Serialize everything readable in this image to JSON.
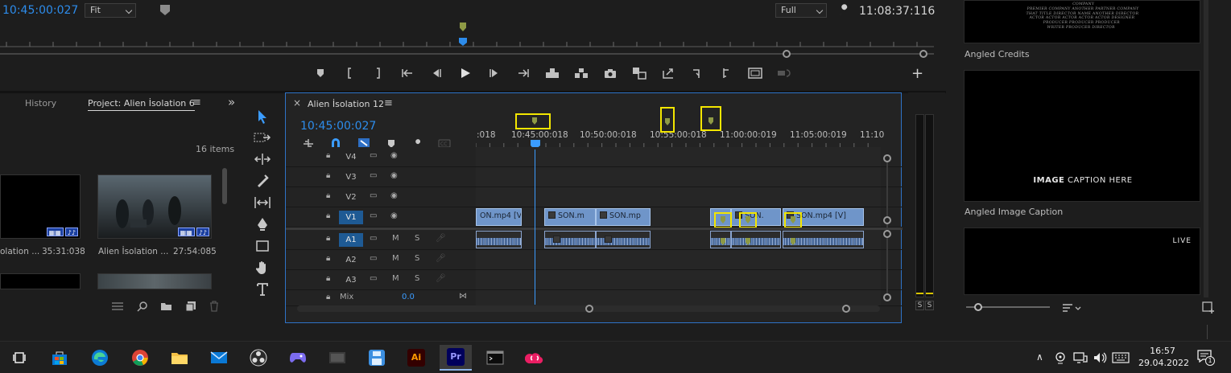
{
  "monitor": {
    "timecode_left": "10:45:00:027",
    "zoom_select": "Fit",
    "quality_select": "Full",
    "timecode_right": "11:08:37:116",
    "transport_icons": [
      "marker-icon",
      "mark-in-icon",
      "mark-out-icon",
      "go-to-in-icon",
      "step-back-icon",
      "play-icon",
      "step-forward-icon",
      "go-to-out-icon",
      "lift-icon",
      "extract-icon",
      "export-frame-icon",
      "compare-icon",
      "insert-icon",
      "trim-icon",
      "trim-end-icon",
      "safe-margins-icon",
      "vr-icon"
    ],
    "add_button": "+"
  },
  "project": {
    "tab_history": "History",
    "tab_project": "Project: Alien İsolation 6",
    "tab_menu": "≡",
    "overflow": "»",
    "item_count": "16 items",
    "items": [
      {
        "name": "olation ...",
        "duration": "35:31:038"
      },
      {
        "name": "Alien İsolation ...",
        "duration": "27:54:085"
      }
    ]
  },
  "timeline": {
    "close": "×",
    "sequence_name": "Alien İsolation 12",
    "menu": "≡",
    "timecode": "10:45:00:027",
    "ruler_ticks": [
      ":018",
      "10:45:00:018",
      "10:50:00:018",
      "10:55:00:018",
      "11:00:00:019",
      "11:05:00:019",
      "11:10"
    ],
    "tracks": [
      {
        "name": "V4",
        "type": "video"
      },
      {
        "name": "V3",
        "type": "video"
      },
      {
        "name": "V2",
        "type": "video"
      },
      {
        "name": "V1",
        "type": "video",
        "selected": true
      },
      {
        "name": "A1",
        "type": "audio",
        "selected": true
      },
      {
        "name": "A2",
        "type": "audio"
      },
      {
        "name": "A3",
        "type": "audio"
      }
    ],
    "mute_label": "M",
    "solo_label": "S",
    "mix_label": "Mix",
    "mix_value": "0.0",
    "video_clips": [
      "ON.mp4 [V]",
      "SON.m",
      "SON.mp",
      "",
      "SON.",
      "SON.mp4 [V]"
    ]
  },
  "meter": {
    "solo_left": "S",
    "solo_right": "S"
  },
  "essential": {
    "credits_lines": [
      "COMPANY",
      "PREMIER COMPANY ANOTHER PARTNER COMPANY",
      "THAT TITLE DIRECTOR NAME ANOTHER DIRECTOR",
      "ACTOR ACTOR ACTOR ACTOR ACTOR DESIGNER",
      "PRODUCER PRODUCER PRODUCER",
      "WRITER PRODUCER DIRECTOR"
    ],
    "items": [
      {
        "label": "Angled Credits"
      },
      {
        "label": "Angled Image Caption",
        "caption_bold": "IMAGE",
        "caption_rest": " CAPTION HERE"
      },
      {
        "label": "",
        "live_text": "LIVE"
      }
    ]
  },
  "taskbar": {
    "apps": [
      "task-view-icon",
      "store-icon",
      "edge-icon",
      "chrome-icon",
      "file-explorer-icon",
      "mail-icon",
      "obs-icon",
      "game-icon",
      "screen-icon",
      "save-icon",
      "illustrator-icon",
      "premiere-icon",
      "terminal-icon",
      "creative-cloud-icon"
    ],
    "illustrator_label": "Ai",
    "premiere_label": "Pr",
    "time": "16:57",
    "date": "29.04.2022",
    "notifications": "1"
  },
  "colors": {
    "accent_blue": "#2d8ceb",
    "marker_yellow": "#f3e600",
    "clip_blue": "#6f95c9",
    "track_selected": "#1e5a94"
  }
}
